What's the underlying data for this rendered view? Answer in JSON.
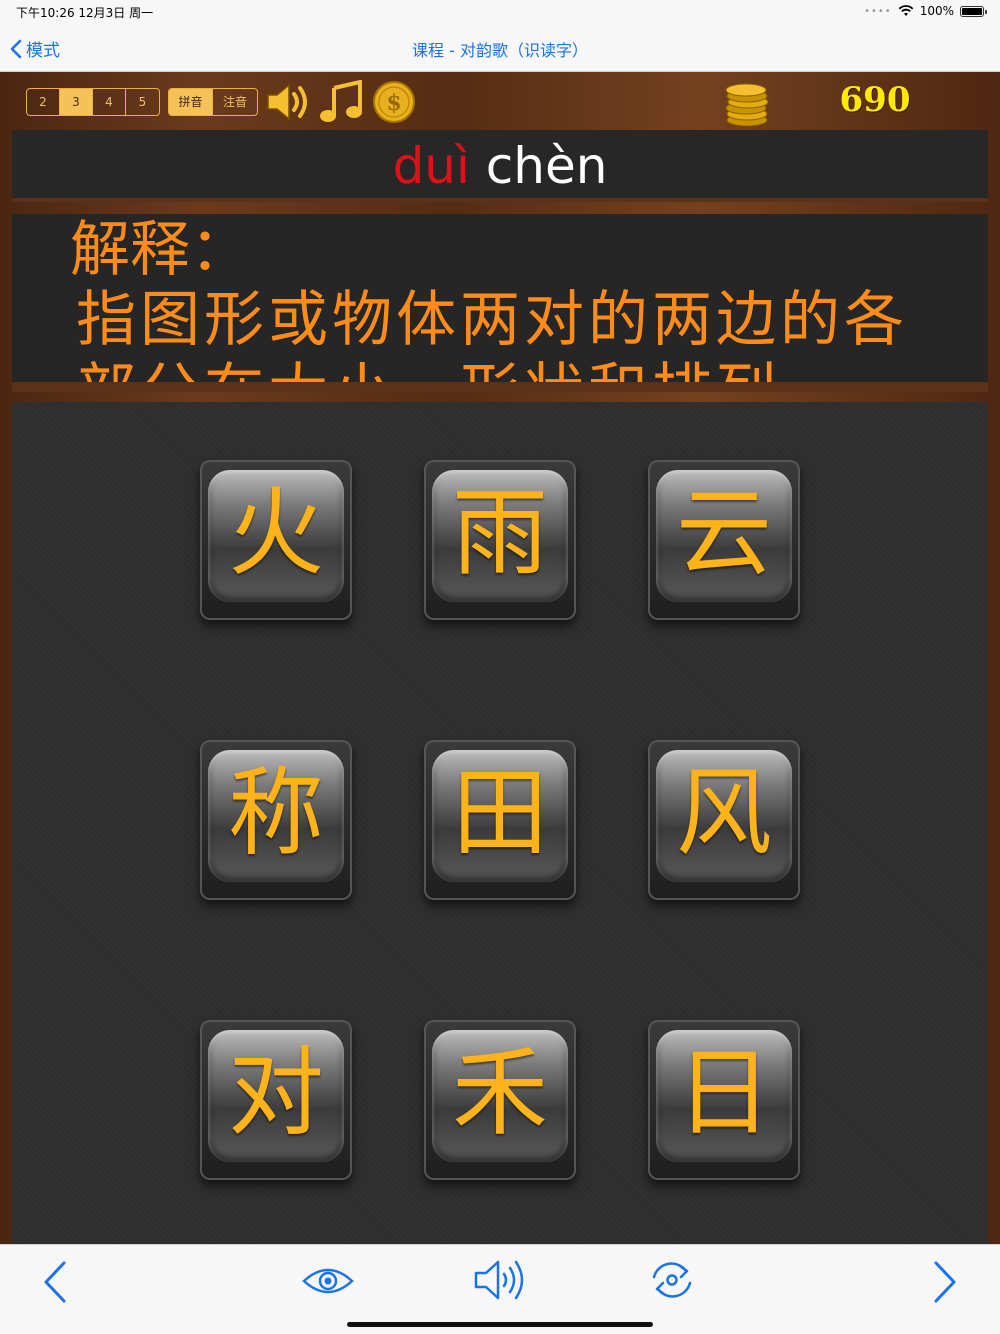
{
  "status": {
    "time": "下午10:26  12月3日 周一",
    "battery": "100%"
  },
  "nav": {
    "back_label": "模式",
    "title": "课程 - 对韵歌（识读字）"
  },
  "toolbar": {
    "count_options": [
      "2",
      "3",
      "4",
      "5"
    ],
    "count_selected": "3",
    "phonetic_options": [
      "拼音",
      "注音"
    ],
    "phonetic_selected": "拼音",
    "score": "690"
  },
  "pinyin": {
    "part1": "duì",
    "part2": "chèn"
  },
  "explanation": {
    "heading": "解释：",
    "text": "指图形或物体两对的两边的各部分在大小、形状和排列"
  },
  "tiles": [
    {
      "char": "火"
    },
    {
      "char": "雨"
    },
    {
      "char": "云"
    },
    {
      "char": "称"
    },
    {
      "char": "田"
    },
    {
      "char": "风"
    },
    {
      "char": "对"
    },
    {
      "char": "禾"
    },
    {
      "char": "日"
    }
  ],
  "colors": {
    "accent": "#1a73e8",
    "tile_char": "#ffb31a",
    "explanation": "#ff8c1a",
    "pinyin_red": "#e0101a",
    "score": "#ffea00"
  }
}
